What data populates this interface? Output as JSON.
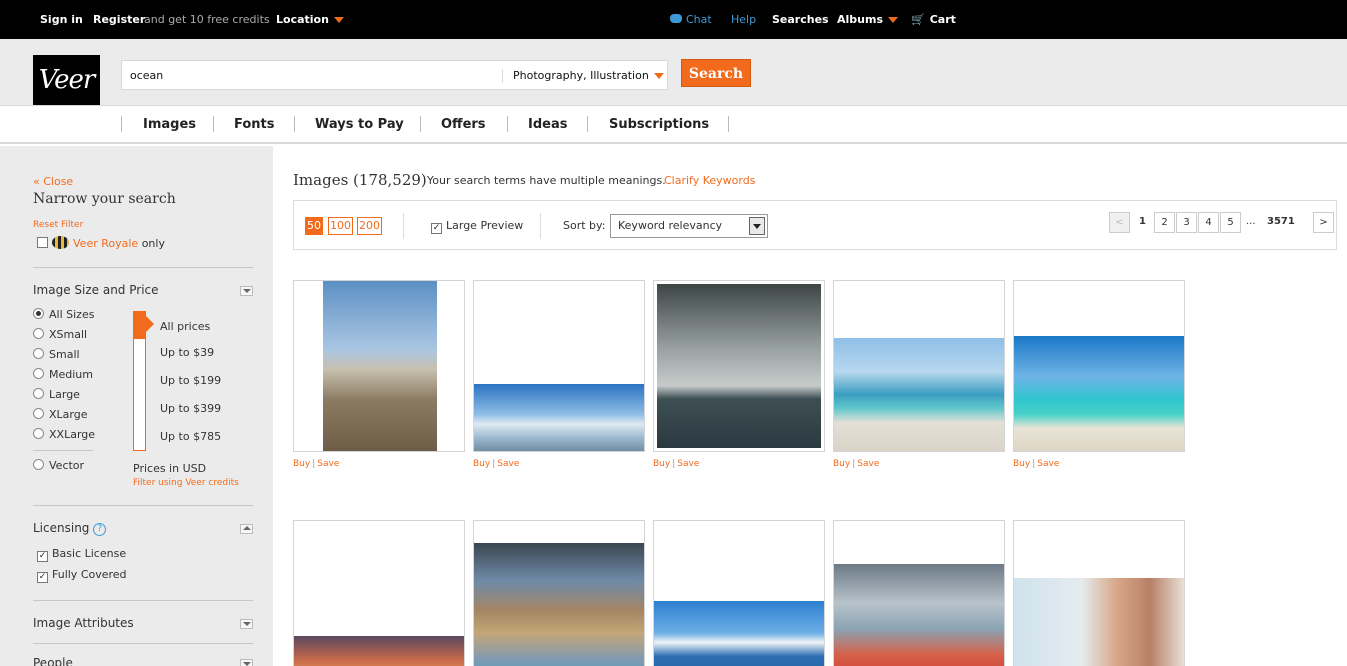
{
  "topbar": {
    "sign_in": "Sign in",
    "register": "Register",
    "register_note": "and get 10 free credits",
    "location": "Location",
    "chat": "Chat",
    "help": "Help",
    "searches": "Searches",
    "albums": "Albums",
    "cart": "Cart"
  },
  "header": {
    "logo": "Veer",
    "query": "ocean",
    "scope": "Photography, Illustration",
    "search_button": "Search"
  },
  "nav": {
    "tabs": [
      "Images",
      "Fonts",
      "Ways to Pay",
      "Offers",
      "Ideas",
      "Subscriptions"
    ]
  },
  "sidebar": {
    "close": "« Close",
    "title": "Narrow your search",
    "reset_filter": "Reset Filter",
    "veer_royale": "Veer Royale",
    "only": "only",
    "size_price_title": "Image Size and Price",
    "sizes": [
      "All Sizes",
      "XSmall",
      "Small",
      "Medium",
      "Large",
      "XLarge",
      "XXLarge"
    ],
    "vector": "Vector",
    "prices": [
      "All prices",
      "Up to $39",
      "Up to $199",
      "Up to $399",
      "Up to $785"
    ],
    "prices_note": "Prices in USD",
    "filter_credits": "Filter using Veer credits",
    "licensing_title": "Licensing",
    "licenses": [
      "Basic License",
      "Fully Covered"
    ],
    "attributes_title": "Image Attributes",
    "people_title": "People"
  },
  "main": {
    "results_title": "Images (178,529)",
    "meanings_note": "Your search terms have multiple meanings.",
    "clarify": "Clarify Keywords",
    "per_page": [
      "50",
      "100",
      "200"
    ],
    "large_preview": "Large Preview",
    "sort_label": "Sort by:",
    "sort_value": "Keyword relevancy",
    "pages": [
      "1",
      "2",
      "3",
      "4",
      "5"
    ],
    "ellipsis": "...",
    "last_page": "3571",
    "buy": "Buy",
    "save": "Save"
  },
  "colors": {
    "accent": "#f26b1d",
    "link_blue": "#3c9bd6"
  }
}
